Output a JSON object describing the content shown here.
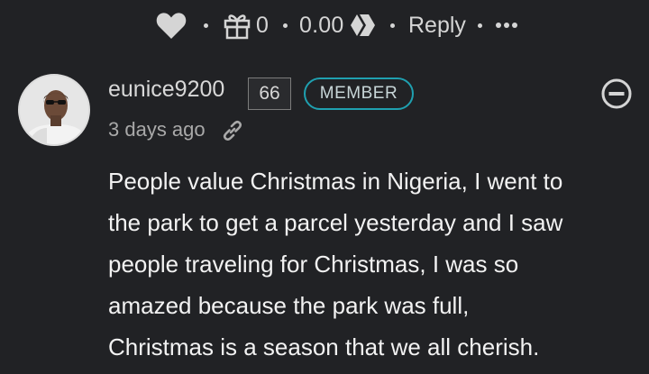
{
  "toolbar": {
    "like_icon": "heart-icon",
    "gift_icon": "gift-icon",
    "gift_count": "0",
    "payout": "0.00",
    "currency_icon": "hive-logo-icon",
    "reply_label": "Reply",
    "more_icon": "more-dots-icon"
  },
  "comment": {
    "author": "eunice9200",
    "reputation": "66",
    "badge": "MEMBER",
    "time_ago": "3 days ago",
    "link_icon": "link-icon",
    "collapse_icon": "collapse-minus-icon",
    "body_lines": [
      "People value Christmas in Nigeria, I went to",
      "the park to get a parcel yesterday and I saw",
      "people traveling for Christmas, I was so",
      "amazed because the park was full,",
      "Christmas is a season that we all cherish."
    ]
  },
  "colors": {
    "background": "#212225",
    "member_badge": "#1fa0b0",
    "text": "#f2f2f2",
    "muted": "#a9a9a9"
  }
}
